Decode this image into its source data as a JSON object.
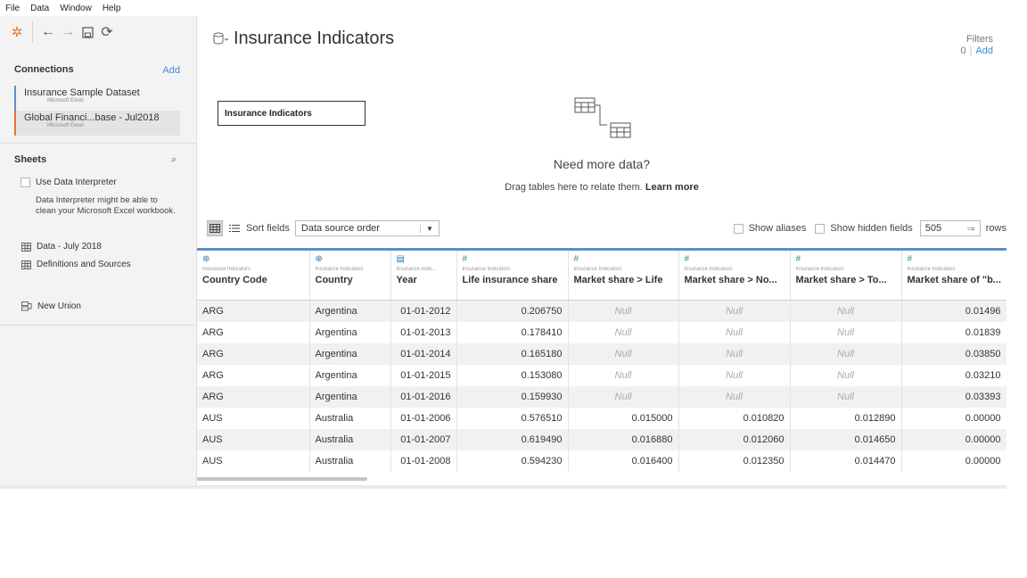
{
  "menu": [
    "File",
    "Data",
    "Window",
    "Help"
  ],
  "sidebar": {
    "connections_label": "Connections",
    "connections_add": "Add",
    "connections": [
      {
        "name": "Insurance Sample Dataset",
        "type": "Microsoft Excel"
      },
      {
        "name": "Global Financi...base - Jul2018",
        "type": "Microsoft Excel"
      }
    ],
    "sheets_label": "Sheets",
    "use_interpreter": "Use Data Interpreter",
    "interpreter_note": "Data Interpreter might be able to clean your Microsoft Excel workbook.",
    "sheets": [
      "Data - July 2018",
      "Definitions and Sources"
    ],
    "new_union": "New Union"
  },
  "main": {
    "title": "Insurance Indicators",
    "filters_label": "Filters",
    "filters_count": "0",
    "filters_add": "Add",
    "table_card": "Insurance Indicators",
    "need_more": "Need more data?",
    "drag_text": "Drag tables here to relate them.",
    "learn_more": "Learn more"
  },
  "gridbar": {
    "sort_label": "Sort fields",
    "sort_value": "Data source order",
    "show_aliases": "Show aliases",
    "show_hidden": "Show hidden fields",
    "rows_value": "505",
    "rows_label": "rows"
  },
  "columns": [
    {
      "icon": "⊕",
      "icon_class": "globe",
      "source": "Insurance Indicators",
      "name": "Country Code"
    },
    {
      "icon": "⊕",
      "icon_class": "globe",
      "source": "Insurance Indicators",
      "name": "Country"
    },
    {
      "icon": "▤",
      "icon_class": "cal",
      "source": "Insurance Indic...",
      "name": "Year"
    },
    {
      "icon": "#",
      "icon_class": "num",
      "source": "Insurance Indicators",
      "name": "Life insurance share"
    },
    {
      "icon": "#",
      "icon_class": "num",
      "source": "Insurance Indicators",
      "name": "Market share > Life"
    },
    {
      "icon": "#",
      "icon_class": "num",
      "source": "Insurance Indicators",
      "name": "Market share > No..."
    },
    {
      "icon": "#",
      "icon_class": "num",
      "source": "Insurance Indicators",
      "name": "Market share > To..."
    },
    {
      "icon": "#",
      "icon_class": "num",
      "source": "Insurance Indicators",
      "name": "Market share of \"b..."
    }
  ],
  "rows": [
    [
      "ARG",
      "Argentina",
      "01-01-2012",
      "0.206750",
      "Null",
      "Null",
      "Null",
      "0.01496"
    ],
    [
      "ARG",
      "Argentina",
      "01-01-2013",
      "0.178410",
      "Null",
      "Null",
      "Null",
      "0.01839"
    ],
    [
      "ARG",
      "Argentina",
      "01-01-2014",
      "0.165180",
      "Null",
      "Null",
      "Null",
      "0.03850"
    ],
    [
      "ARG",
      "Argentina",
      "01-01-2015",
      "0.153080",
      "Null",
      "Null",
      "Null",
      "0.03210"
    ],
    [
      "ARG",
      "Argentina",
      "01-01-2016",
      "0.159930",
      "Null",
      "Null",
      "Null",
      "0.03393"
    ],
    [
      "AUS",
      "Australia",
      "01-01-2006",
      "0.576510",
      "0.015000",
      "0.010820",
      "0.012890",
      "0.00000"
    ],
    [
      "AUS",
      "Australia",
      "01-01-2007",
      "0.619490",
      "0.016880",
      "0.012060",
      "0.014650",
      "0.00000"
    ],
    [
      "AUS",
      "Australia",
      "01-01-2008",
      "0.594230",
      "0.016400",
      "0.012350",
      "0.014470",
      "0.00000"
    ]
  ]
}
